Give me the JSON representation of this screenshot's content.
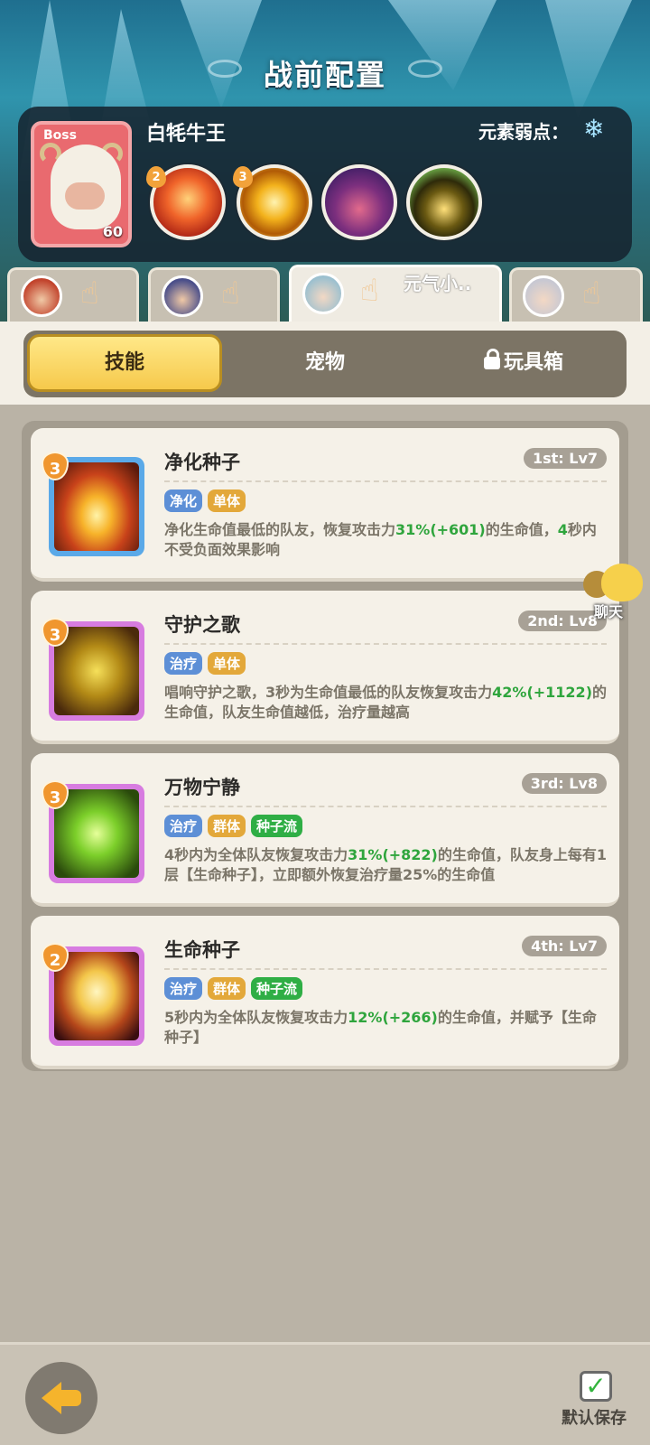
{
  "header": {
    "title": "战前配置"
  },
  "boss": {
    "tag": "Boss",
    "name": "白牦牛王",
    "level": "60",
    "element_weakness_label": "元素弱点：",
    "weakness_icon": "snowflake-icon",
    "skills": [
      {
        "badge": "2",
        "icon": "fire-bird-icon"
      },
      {
        "badge": "3",
        "icon": "gold-swirl-icon"
      },
      {
        "badge": "",
        "icon": "purple-beast-icon"
      },
      {
        "badge": "",
        "icon": "green-ogre-icon"
      }
    ]
  },
  "party": {
    "active_name": "元气小.."
  },
  "tabs": {
    "skill": "技能",
    "pet": "宠物",
    "toybox": "玩具箱"
  },
  "skills": [
    {
      "level": "3",
      "name": "净化种子",
      "slot": "1st: Lv7",
      "tags": [
        "净化",
        "单体"
      ],
      "desc_a": "净化生命值最低的队友，恢复攻击力",
      "pct": "31%",
      "bonus": "(+601)",
      "desc_b": "的生命值，",
      "num": "4",
      "desc_c": "秒内不受负面效果影响"
    },
    {
      "level": "3",
      "name": "守护之歌",
      "slot": "2nd: Lv8",
      "tags": [
        "治疗",
        "单体"
      ],
      "desc_a": "唱响守护之歌，3秒为生命值最低的队友恢复攻击力",
      "pct": "42%",
      "bonus": "(+1122)",
      "desc_b": "的生命值，队友生命值越低，治疗量越高"
    },
    {
      "level": "3",
      "name": "万物宁静",
      "slot": "3rd: Lv8",
      "tags": [
        "治疗",
        "群体",
        "种子流"
      ],
      "desc_a": "4秒内为全体队友恢复攻击力",
      "pct": "31%",
      "bonus": "(+822)",
      "desc_b": "的生命值，队友身上每有1层【生命种子】，立即额外恢复治疗量25%的生命值"
    },
    {
      "level": "2",
      "name": "生命种子",
      "slot": "4th: Lv7",
      "tags": [
        "治疗",
        "群体",
        "种子流"
      ],
      "desc_a": "5秒内为全体队友恢复攻击力",
      "pct": "12%",
      "bonus": "(+266)",
      "desc_b": "的生命值，并赋予【生命种子】"
    }
  ],
  "chat": {
    "label": "聊天"
  },
  "footer": {
    "save_label": "默认保存"
  }
}
